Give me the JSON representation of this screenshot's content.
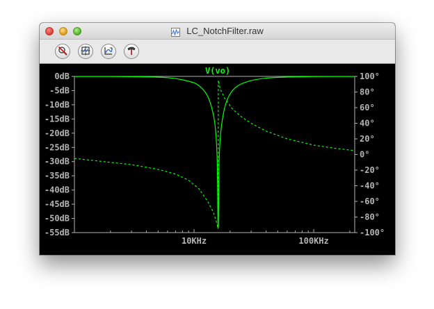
{
  "window": {
    "title": "LC_NotchFilter.raw"
  },
  "toolbar": {
    "buttons": [
      {
        "name": "zoom-cancel-icon"
      },
      {
        "name": "zoom-extents-icon"
      },
      {
        "name": "autorange-icon"
      },
      {
        "name": "probe-icon"
      }
    ]
  },
  "colors": {
    "trace": "#00ff00",
    "axis": "#b4b4b4",
    "plot_bg": "#000000"
  },
  "chart_data": {
    "type": "line",
    "trace_label": "V(vo)",
    "x_scale": "log",
    "xlim_hz": [
      1000,
      220000
    ],
    "x_ticks": [
      {
        "value": 10000,
        "label": "10KHz"
      },
      {
        "value": 100000,
        "label": "100KHz"
      }
    ],
    "y_left": {
      "unit": "dB",
      "ylim": [
        -55,
        0
      ],
      "ticks": [
        "0dB",
        "-5dB",
        "-10dB",
        "-15dB",
        "-20dB",
        "-25dB",
        "-30dB",
        "-35dB",
        "-40dB",
        "-45dB",
        "-50dB",
        "-55dB"
      ]
    },
    "y_right": {
      "unit": "deg",
      "ylim": [
        -100,
        100
      ],
      "ticks": [
        "100°",
        "80°",
        "60°",
        "40°",
        "20°",
        "0°",
        "-20°",
        "-40°",
        "-60°",
        "-80°",
        "-100°"
      ]
    },
    "notch_frequency_hz": 15900,
    "series": [
      {
        "style": "solid",
        "x": [
          1000,
          3000,
          6000,
          9000,
          11000,
          13000,
          14500,
          15200,
          15600,
          15900,
          16200,
          16600,
          17500,
          19000,
          22000,
          28000,
          40000,
          60000,
          100000,
          220000
        ],
        "y": [
          -0.02,
          -0.1,
          -0.45,
          -1.7,
          -3.3,
          -7.0,
          -13.5,
          -20.0,
          -30.0,
          -53.5,
          -30.0,
          -21.0,
          -13.5,
          -8.0,
          -4.0,
          -1.8,
          -0.6,
          -0.25,
          -0.08,
          -0.02
        ]
      },
      {
        "style": "dashed",
        "x": [
          1000,
          2000,
          3000,
          5000,
          7000,
          9000,
          11000,
          13000,
          14500,
          15500,
          15850,
          15950,
          16500,
          18000,
          21000,
          25000,
          30000,
          40000,
          60000,
          100000,
          150000,
          220000
        ],
        "y": [
          -5,
          -10,
          -13,
          -19,
          -25,
          -33,
          -44,
          -60,
          -74,
          -88,
          -95,
          95,
          84,
          72,
          58,
          48,
          40,
          30,
          20,
          12,
          8,
          5
        ]
      }
    ]
  }
}
